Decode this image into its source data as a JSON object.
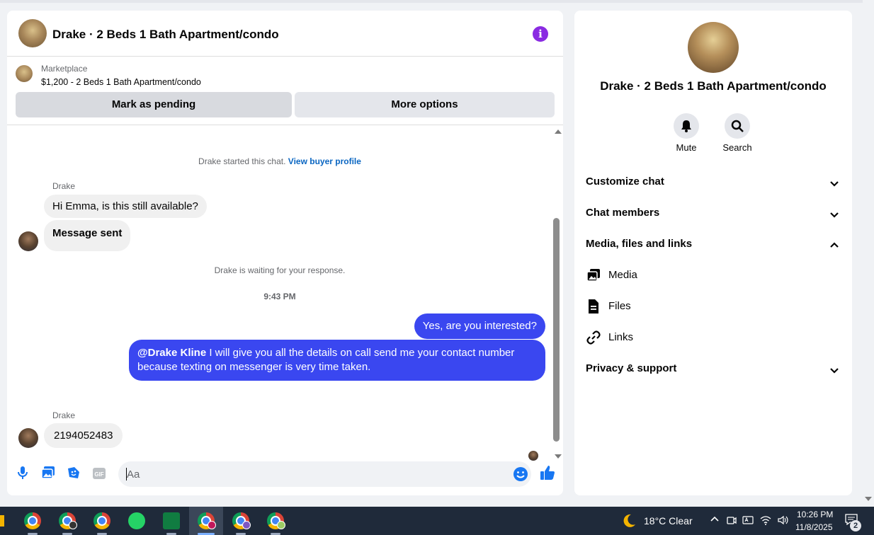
{
  "chat": {
    "title": "Drake · 2 Beds 1 Bath Apartment/condo",
    "marketplace_label": "Marketplace",
    "listing": "$1,200 - 2 Beds 1 Bath Apartment/condo",
    "mark_pending": "Mark as pending",
    "more_options": "More options",
    "started_text": "Drake started this chat.",
    "buyer_profile_link": "View buyer profile",
    "messages": [
      {
        "sender": "Drake",
        "text": "Hi Emma, is this still available?"
      },
      {
        "text": "Message sent"
      }
    ],
    "waiting_text": "Drake is waiting for your response.",
    "time": "9:43 PM",
    "outgoing": [
      {
        "text": "Yes, are you interested?"
      },
      {
        "mention": "@Drake Kline",
        "text": " I will give you all the details on call send me your contact number because texting on messenger is very time taken."
      }
    ],
    "reply": {
      "sender": "Drake",
      "text": "2194052483"
    },
    "composer_placeholder": "Aa",
    "accent": "#3a47f0"
  },
  "side": {
    "title": "Drake · 2 Beds 1 Bath Apartment/condo",
    "mute": "Mute",
    "search": "Search",
    "sections": {
      "customize": "Customize chat",
      "members": "Chat members",
      "media": "Media, files and links",
      "privacy": "Privacy & support"
    },
    "media_items": {
      "media": "Media",
      "files": "Files",
      "links": "Links"
    }
  },
  "taskbar": {
    "weather": "18°C  Clear",
    "time": "10:26 PM",
    "date": "11/8/2025",
    "notifications": "2"
  }
}
